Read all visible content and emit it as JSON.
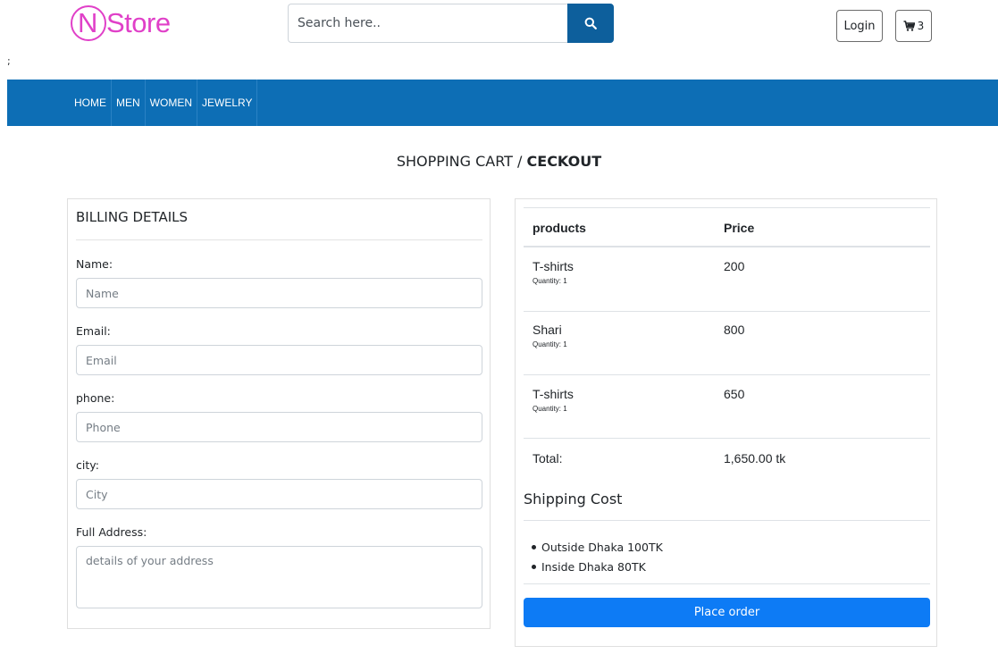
{
  "header": {
    "logo_letter": "N",
    "logo_text": "Store",
    "search_placeholder": "Search here..",
    "search_icon": "search-icon",
    "login_label": "Login",
    "cart_icon": "cart-icon",
    "cart_count": "3",
    "stray_text": ";"
  },
  "nav": {
    "items": [
      {
        "label": "HOME"
      },
      {
        "label": "MEN"
      },
      {
        "label": "WOMEN"
      },
      {
        "label": "JEWELRY"
      }
    ]
  },
  "page_title": {
    "prefix": "SHOPPING CART / ",
    "current": "CECKOUT"
  },
  "billing": {
    "title": "BILLING DETAILS",
    "fields": [
      {
        "label": "Name:",
        "placeholder": "Name",
        "value": ""
      },
      {
        "label": "Email:",
        "placeholder": "Email",
        "value": ""
      },
      {
        "label": "phone:",
        "placeholder": "Phone",
        "value": ""
      },
      {
        "label": "city:",
        "placeholder": "City",
        "value": ""
      },
      {
        "label": "Full Address:",
        "placeholder": "details of your address",
        "value": ""
      }
    ]
  },
  "order": {
    "headers": {
      "product": "products",
      "price": "Price"
    },
    "items": [
      {
        "name": "T-shirts",
        "quantity": "Quantity: 1",
        "price": "200"
      },
      {
        "name": "Shari",
        "quantity": "Quantity: 1",
        "price": "800"
      },
      {
        "name": "T-shirts",
        "quantity": "Quantity: 1",
        "price": "650"
      }
    ],
    "total_label": "Total:",
    "total_value": "1,650.00 tk",
    "shipping_title": "Shipping Cost",
    "shipping_options": [
      {
        "text": "Outside Dhaka 100TK"
      },
      {
        "text": "Inside Dhaka 80TK"
      }
    ],
    "place_order_label": "Place order"
  },
  "colors": {
    "brand": "#e040c8",
    "navbar": "#0d6eb5",
    "search_button": "#0d5f9c",
    "primary_button": "#0d7bf5"
  }
}
